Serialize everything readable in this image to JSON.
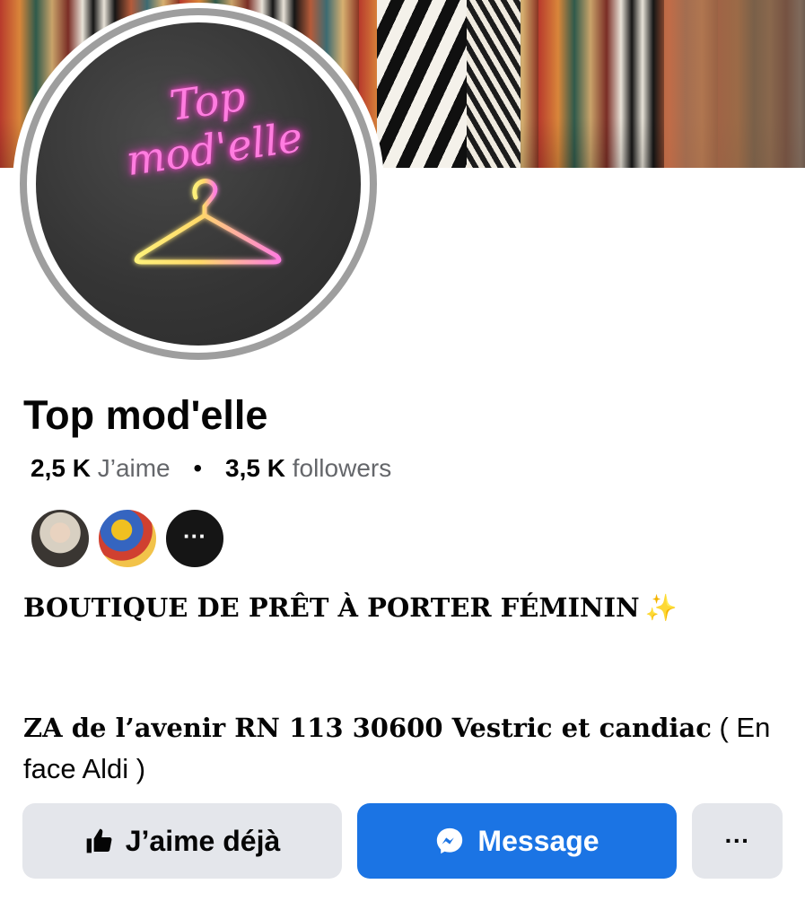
{
  "page": {
    "name": "Top mod'elle",
    "logo_text": "Top mod'elle",
    "stats": {
      "likes_count": "2,5 K",
      "likes_label": "J’aime",
      "separator": "•",
      "followers_count": "3,5 K",
      "followers_label": "followers"
    },
    "friends": {
      "more_label": "···"
    },
    "bio": {
      "text": "BOUTIQUE DE PRÊT À PORTER FÉMININ",
      "emoji": "✨"
    },
    "address": {
      "main": "ZA de l’avenir RN 113 30600 Vestric et candiac",
      "note": " ( En face Aldi )"
    },
    "actions": {
      "like_label": "J’aime déjà",
      "message_label": "Message",
      "more_label": "···"
    }
  },
  "colors": {
    "accent": "#1b74e4",
    "button_secondary": "#e4e6eb",
    "text_primary": "#050505",
    "text_secondary": "#65676b",
    "avatar_border": "#9e9e9e",
    "neon_pink": "#ff7de0"
  },
  "icons": {
    "like": "thumbs-up-icon",
    "message": "messenger-icon",
    "more": "more-horizontal-icon"
  }
}
